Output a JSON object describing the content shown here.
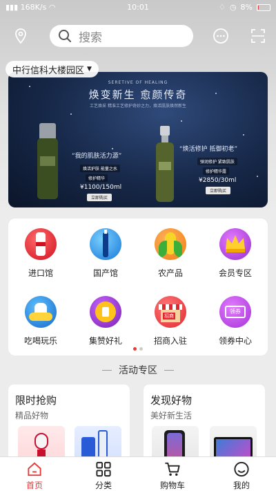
{
  "status_bar": {
    "signal": "168K/s",
    "time": "10:01",
    "battery": "8%",
    "battery_level": 0.08
  },
  "header": {
    "search_placeholder": "搜索",
    "location": "中行信科大楼园区"
  },
  "banner": {
    "title_en": "SERETIVE OF HEALING",
    "headline": "焕变新生  愈颜传奇",
    "subline": "工艺焕采 精准工艺修护奇妙之力，焕活肌肤焕然新生",
    "left": {
      "tagline": "“我的肌肤活力源”",
      "chip1": "焕活护肤 能量之水",
      "chip2": "修护精华",
      "price": "¥1100/150ml",
      "buy": "立即购买"
    },
    "right": {
      "tagline": "“焕活修护 抵御初老”",
      "chip1": "弹润修护 紧致肌肤",
      "chip2": "修护精华露",
      "price": "¥2850/30ml",
      "buy": "立即购买"
    }
  },
  "menu": {
    "items": [
      {
        "label": "进口馆",
        "icon": "import-icon"
      },
      {
        "label": "国产馆",
        "icon": "domestic-icon"
      },
      {
        "label": "农产品",
        "icon": "corn-icon"
      },
      {
        "label": "会员专区",
        "icon": "crown-icon"
      },
      {
        "label": "吃喝玩乐",
        "icon": "leisure-icon"
      },
      {
        "label": "集赞好礼",
        "icon": "thumbs-up-icon"
      },
      {
        "label": "招商入驻",
        "icon": "shop-icon"
      },
      {
        "label": "领券中心",
        "icon": "coupon-icon"
      }
    ],
    "coupon_badge": "领券",
    "shop_badge": "招商",
    "page_count": 2,
    "active_page": 1
  },
  "section_title": "活动专区",
  "cards": [
    {
      "title": "限时抢购",
      "subtitle": "精品好物"
    },
    {
      "title": "发现好物",
      "subtitle": "美好新生活"
    }
  ],
  "tabbar": {
    "items": [
      {
        "label": "首页",
        "icon": "home-icon"
      },
      {
        "label": "分类",
        "icon": "category-icon"
      },
      {
        "label": "购物车",
        "icon": "cart-icon"
      },
      {
        "label": "我的",
        "icon": "profile-icon"
      }
    ],
    "active": 0
  },
  "colors": {
    "accent": "#e43b3b",
    "banner_bg": "#162747"
  }
}
